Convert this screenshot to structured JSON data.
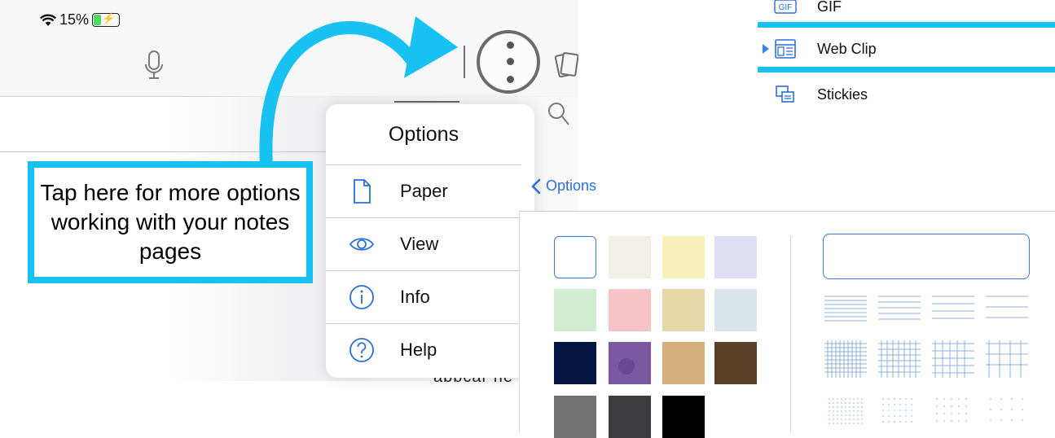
{
  "status_bar": {
    "battery_percent": "15%"
  },
  "callout": {
    "text": "Tap here for more options working with your notes pages"
  },
  "options_menu": {
    "title": "Options",
    "items": [
      {
        "label": "Paper",
        "icon": "document-icon"
      },
      {
        "label": "View",
        "icon": "eye-icon"
      },
      {
        "label": "Info",
        "icon": "info-icon"
      },
      {
        "label": "Help",
        "icon": "question-icon"
      }
    ]
  },
  "insert_menu": {
    "items": [
      {
        "label": "GIF",
        "icon": "gif-icon",
        "icon_text": "GIF"
      },
      {
        "label": "Web Clip",
        "icon": "web-clip-icon",
        "selected": true
      },
      {
        "label": "Stickies",
        "icon": "stickies-icon"
      }
    ]
  },
  "paper_options": {
    "back_label": "Options",
    "colors": [
      {
        "name": "white",
        "color": "#ffffff",
        "selected": true
      },
      {
        "name": "ivory",
        "color": "#f2efe9"
      },
      {
        "name": "light-yellow",
        "color": "#f8f1bc"
      },
      {
        "name": "lavender",
        "color": "#dfdff2"
      },
      {
        "name": "mint",
        "color": "#d2ecd0"
      },
      {
        "name": "pink",
        "color": "#f6c3c6"
      },
      {
        "name": "tan",
        "color": "#e6d8a8"
      },
      {
        "name": "light-blue",
        "color": "#d9e6e9"
      },
      {
        "name": "navy",
        "color": "#041641"
      },
      {
        "name": "purple",
        "color": "#7c58a3"
      },
      {
        "name": "cork",
        "color": "#d6b07e"
      },
      {
        "name": "brown",
        "color": "#5b4029"
      },
      {
        "name": "gray",
        "color": "#737373"
      },
      {
        "name": "charcoal",
        "color": "#3d3d40"
      },
      {
        "name": "black",
        "color": "#000000"
      }
    ],
    "line_color": "#8fb1d8"
  },
  "colors": {
    "accent": "#17c1f1",
    "link_blue": "#2b6fd6"
  }
}
